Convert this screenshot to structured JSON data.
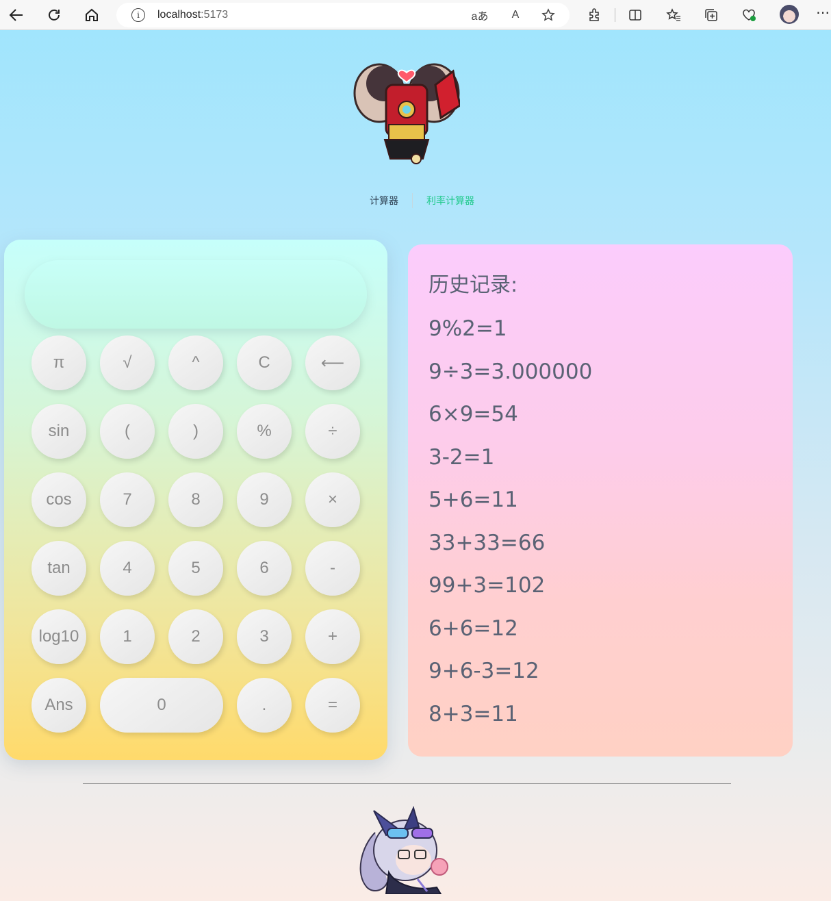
{
  "browser": {
    "url_host": "localhost",
    "url_port": ":5173",
    "info_icon_glyph": "i",
    "read_aloud_text": "A",
    "translate_text": "aあ"
  },
  "tabs": [
    {
      "label": "计算器"
    },
    {
      "label": "利率计算器"
    }
  ],
  "calculator": {
    "display_value": "",
    "keys": [
      [
        "π",
        "√",
        "^",
        "C",
        "⟵"
      ],
      [
        "sin",
        "(",
        ")",
        "%",
        "÷"
      ],
      [
        "cos",
        "7",
        "8",
        "9",
        "×"
      ],
      [
        "tan",
        "4",
        "5",
        "6",
        "-"
      ],
      [
        "log10",
        "1",
        "2",
        "3",
        "+"
      ],
      [
        "Ans",
        "0",
        ".",
        "="
      ]
    ]
  },
  "history": {
    "title": "历史记录:",
    "entries": [
      "9%2=1",
      "9÷3=3.000000",
      "6×9=54",
      "3-2=1",
      "5+6=11",
      "33+33=66",
      "99+3=102",
      "6+6=12",
      "9+6-3=12",
      "8+3=11"
    ]
  },
  "colors": {
    "link_tab": "#1ec98a",
    "key_text": "#8c8c8c",
    "history_text": "#5a6274"
  }
}
